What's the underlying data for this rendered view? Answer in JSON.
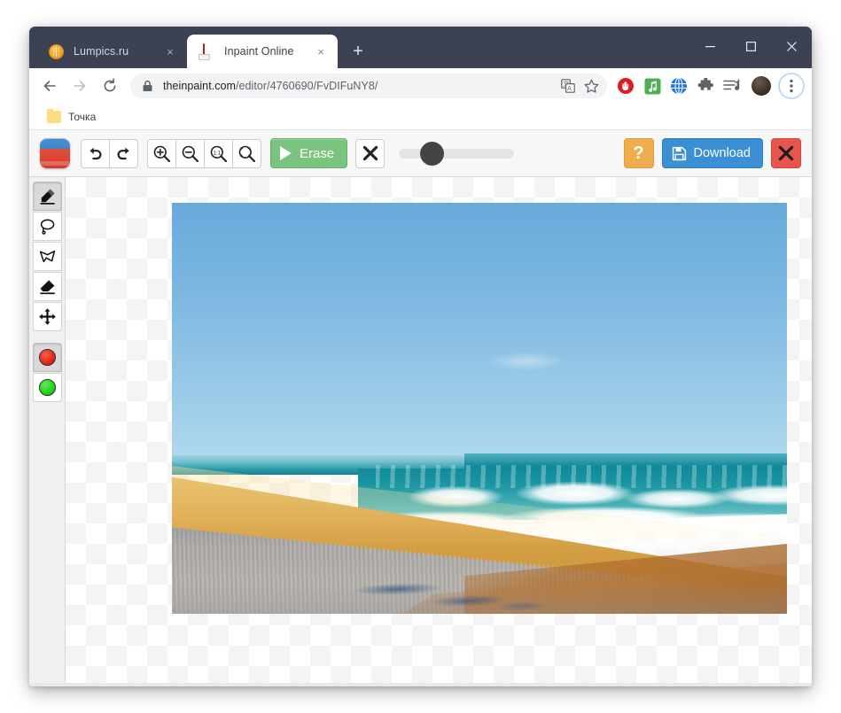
{
  "browser": {
    "window_controls": {
      "minimize": "minimize-button",
      "maximize": "maximize-button",
      "close": "close-button"
    },
    "tabs": [
      {
        "title": "Lumpics.ru",
        "favicon": "orange-circle-icon",
        "active": false,
        "close_label": "×"
      },
      {
        "title": "Inpaint Online",
        "favicon": "eraser-icon",
        "active": true,
        "close_label": "×"
      }
    ],
    "new_tab_label": "+",
    "nav": {
      "back_label": "←",
      "forward_label": "→",
      "reload_label": "⟳"
    },
    "omnibox": {
      "lock_icon": "lock-icon",
      "url_domain": "theinpaint.com",
      "url_path": "/editor/4760690/FvDIFuNY8/",
      "url_full": "theinpaint.com/editor/4760690/FvDIFuNY8/",
      "translate_icon": "translate-icon",
      "bookmark_star_icon": "star-icon"
    },
    "extensions": [
      {
        "name": "adblock-extension-icon",
        "color": "#e01b24"
      },
      {
        "name": "music-extension-icon",
        "color": "#4caf50"
      },
      {
        "name": "globe-extension-icon",
        "color": "#1a73e8"
      },
      {
        "name": "puzzle-extensions-icon",
        "color": "#5f6368"
      },
      {
        "name": "playlist-extension-icon",
        "color": "#5f6368"
      }
    ],
    "avatar": "profile-avatar",
    "menu_icon": "three-dot-menu-icon",
    "bookmarks": [
      {
        "label": "Точка",
        "icon": "folder-icon"
      }
    ]
  },
  "app": {
    "logo": "inpaint-logo",
    "toolbar": {
      "undo_label": "undo-icon",
      "redo_label": "redo-icon",
      "zoom_in_label": "zoom-in-icon",
      "zoom_out_label": "zoom-out-icon",
      "zoom_actual_label": "1:1",
      "zoom_fit_label": "zoom-fit-icon",
      "erase_label": "Erase",
      "clear_label": "clear-selection-icon",
      "brush_size_percent": 25,
      "help_label": "?",
      "download_label": "Download",
      "close_label": "close-editor-icon"
    },
    "tools": [
      {
        "name": "marker-tool",
        "icon": "marker-icon",
        "selected": true
      },
      {
        "name": "lasso-tool",
        "icon": "lasso-icon",
        "selected": false
      },
      {
        "name": "polygon-lasso-tool",
        "icon": "polygon-lasso-icon",
        "selected": false
      },
      {
        "name": "eraser-tool",
        "icon": "eraser-icon",
        "selected": false
      },
      {
        "name": "move-tool",
        "icon": "move-arrows-icon",
        "selected": false
      }
    ],
    "swatches": [
      {
        "name": "red-swatch",
        "color": "#e02a18",
        "selected": true
      },
      {
        "name": "green-swatch",
        "color": "#20d51a",
        "selected": false
      }
    ],
    "canvas": {
      "background": "transparency-checkerboard",
      "image_alt": "beach-photo-sand-sea-waves"
    }
  },
  "colors": {
    "titlebar": "#3c4254",
    "erase_green": "#7ac47f",
    "download_blue": "#3b8fd4",
    "help_orange": "#f0ad4e",
    "close_red": "#e8554d"
  }
}
